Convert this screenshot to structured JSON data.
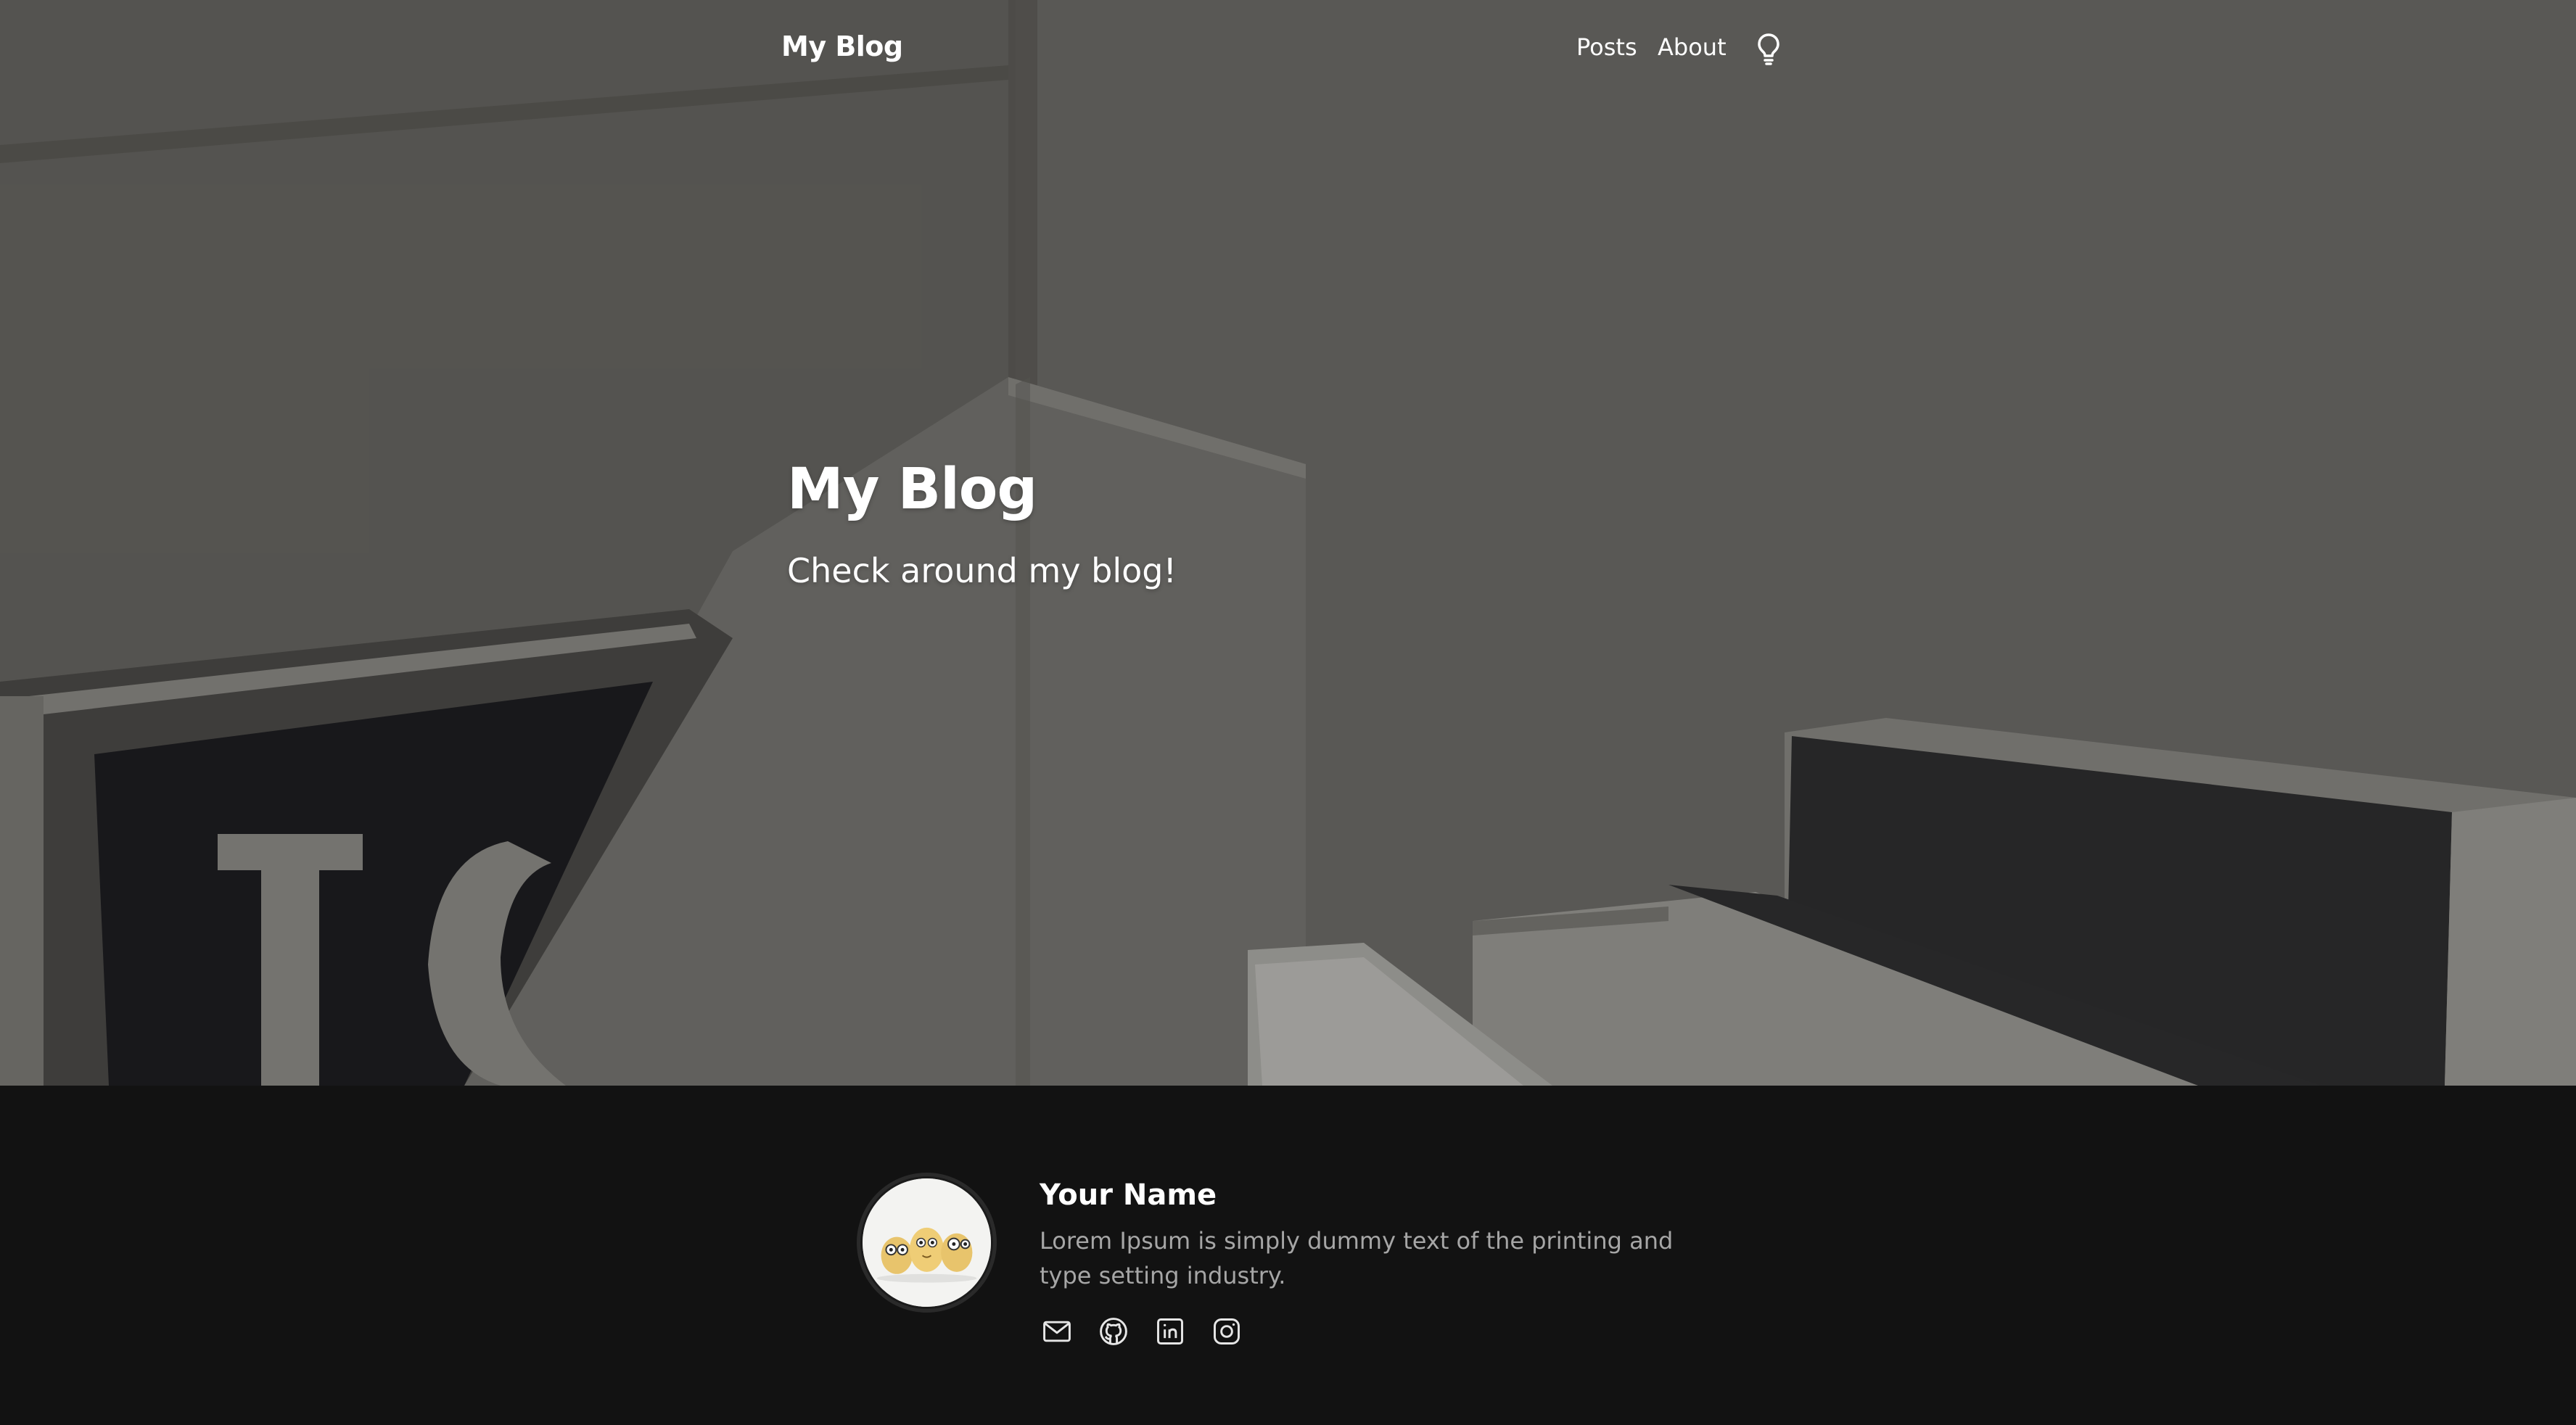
{
  "navbar": {
    "brand": "My Blog",
    "links": [
      {
        "label": "Posts"
      },
      {
        "label": "About"
      }
    ],
    "theme_toggle_icon": "lightbulb-icon"
  },
  "hero": {
    "title": "My Blog",
    "subtitle": "Check around my blog!"
  },
  "footer": {
    "author_name": "Your Name",
    "author_bio": "Lorem Ipsum is simply dummy text of the printing and type setting industry.",
    "social_icons": [
      "mail-icon",
      "github-icon",
      "linkedin-icon",
      "instagram-icon"
    ]
  },
  "colors": {
    "footer_background": "#121212",
    "bio_text": "#a6a6a6",
    "text": "#ffffff"
  }
}
